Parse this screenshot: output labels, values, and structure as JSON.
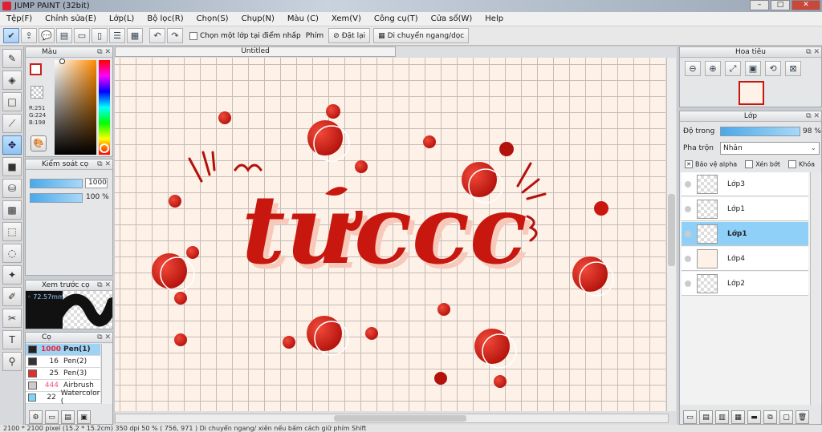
{
  "app": {
    "title": "JUMP PAINT (32bit)"
  },
  "menu": [
    "Tệp(F)",
    "Chỉnh sửa(E)",
    "Lớp(L)",
    "Bộ lọc(R)",
    "Chọn(S)",
    "Chụp(N)",
    "Màu (C)",
    "Xem(V)",
    "Công cụ(T)",
    "Cửa sổ(W)",
    "Help"
  ],
  "toolbar": {
    "select_layer_on_click": "Chọn một lớp tại điểm nhấp",
    "key_label": "Phím",
    "reset_label": "Đặt lại",
    "move_mode_label": "Di chuyển ngang/dọc"
  },
  "color_panel": {
    "title": "Màu",
    "r": "R:251",
    "g": "G:224",
    "b": "B:198",
    "primary": "#cc1f1a",
    "secondary": "#f3d36a"
  },
  "brush_control": {
    "title": "Kiểm soát cọ",
    "size_value": "1000",
    "opacity_value": "100",
    "opacity_unit": "%"
  },
  "brush_preview": {
    "title": "Xem trước cọ",
    "size_text": "72.57mm"
  },
  "brushes": {
    "title": "Cọ",
    "items": [
      {
        "size": "1000",
        "name": "Pen(1)",
        "color": "#222222"
      },
      {
        "size": "16",
        "name": "Pen(2)",
        "color": "#333333"
      },
      {
        "size": "25",
        "name": "Pen(3)",
        "color": "#e03030"
      },
      {
        "size": "444",
        "name": "Airbrush",
        "color": "#cccccc"
      },
      {
        "size": "22",
        "name": "Watercolor (",
        "color": "#7fd3f7"
      }
    ]
  },
  "document": {
    "tab": "Untitled",
    "art_text": "tưccc",
    "accent": "#c8170f"
  },
  "navigator": {
    "title": "Hoa tiêu"
  },
  "layers": {
    "title": "Lớp",
    "opacity_label": "Độ trong",
    "opacity_value": "98 %",
    "blend_label": "Pha trộn",
    "blend_value": "Nhân",
    "protect_alpha": "Bảo vệ alpha",
    "clipping": "Xén bớt",
    "lock": "Khóa",
    "items": [
      {
        "name": "Lớp3"
      },
      {
        "name": "Lớp1"
      },
      {
        "name": "Lớp1"
      },
      {
        "name": "Lớp4"
      },
      {
        "name": "Lớp2"
      }
    ]
  },
  "status": {
    "text": "2100 * 2100 pixel   (15.2 * 15.2cm)   350 dpi   50 %   ( 756, 971 )   Di chuyển ngang/ xiên nếu bấm cách giữ phím Shift"
  }
}
